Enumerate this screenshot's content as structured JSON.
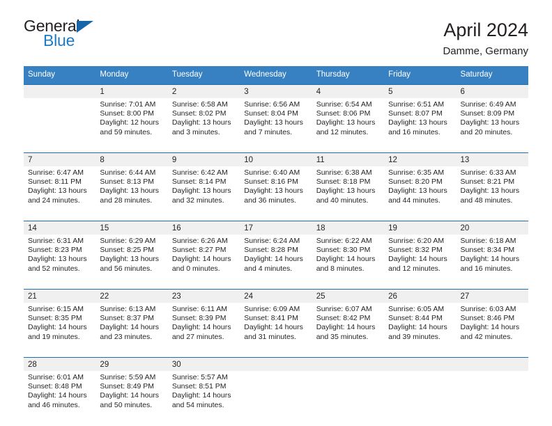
{
  "brand": {
    "name_part1": "General",
    "name_part2": "Blue",
    "accent_color": "#1f7ac4",
    "triangle_color": "#1565a8",
    "logo_icon": "triangle-icon"
  },
  "header": {
    "title": "April 2024",
    "subtitle": "Damme, Germany"
  },
  "theme": {
    "header_row_bg": "#3781c2",
    "daynum_band_bg": "#f0f0f0",
    "week_divider": "#1f6cae",
    "text_color": "#231f20"
  },
  "weekdays": [
    "Sunday",
    "Monday",
    "Tuesday",
    "Wednesday",
    "Thursday",
    "Friday",
    "Saturday"
  ],
  "weeks": [
    {
      "days": [
        {
          "num": "",
          "l1": "",
          "l2": "",
          "l3": "",
          "l4": ""
        },
        {
          "num": "1",
          "l1": "Sunrise: 7:01 AM",
          "l2": "Sunset: 8:00 PM",
          "l3": "Daylight: 12 hours",
          "l4": "and 59 minutes."
        },
        {
          "num": "2",
          "l1": "Sunrise: 6:58 AM",
          "l2": "Sunset: 8:02 PM",
          "l3": "Daylight: 13 hours",
          "l4": "and 3 minutes."
        },
        {
          "num": "3",
          "l1": "Sunrise: 6:56 AM",
          "l2": "Sunset: 8:04 PM",
          "l3": "Daylight: 13 hours",
          "l4": "and 7 minutes."
        },
        {
          "num": "4",
          "l1": "Sunrise: 6:54 AM",
          "l2": "Sunset: 8:06 PM",
          "l3": "Daylight: 13 hours",
          "l4": "and 12 minutes."
        },
        {
          "num": "5",
          "l1": "Sunrise: 6:51 AM",
          "l2": "Sunset: 8:07 PM",
          "l3": "Daylight: 13 hours",
          "l4": "and 16 minutes."
        },
        {
          "num": "6",
          "l1": "Sunrise: 6:49 AM",
          "l2": "Sunset: 8:09 PM",
          "l3": "Daylight: 13 hours",
          "l4": "and 20 minutes."
        }
      ]
    },
    {
      "days": [
        {
          "num": "7",
          "l1": "Sunrise: 6:47 AM",
          "l2": "Sunset: 8:11 PM",
          "l3": "Daylight: 13 hours",
          "l4": "and 24 minutes."
        },
        {
          "num": "8",
          "l1": "Sunrise: 6:44 AM",
          "l2": "Sunset: 8:13 PM",
          "l3": "Daylight: 13 hours",
          "l4": "and 28 minutes."
        },
        {
          "num": "9",
          "l1": "Sunrise: 6:42 AM",
          "l2": "Sunset: 8:14 PM",
          "l3": "Daylight: 13 hours",
          "l4": "and 32 minutes."
        },
        {
          "num": "10",
          "l1": "Sunrise: 6:40 AM",
          "l2": "Sunset: 8:16 PM",
          "l3": "Daylight: 13 hours",
          "l4": "and 36 minutes."
        },
        {
          "num": "11",
          "l1": "Sunrise: 6:38 AM",
          "l2": "Sunset: 8:18 PM",
          "l3": "Daylight: 13 hours",
          "l4": "and 40 minutes."
        },
        {
          "num": "12",
          "l1": "Sunrise: 6:35 AM",
          "l2": "Sunset: 8:20 PM",
          "l3": "Daylight: 13 hours",
          "l4": "and 44 minutes."
        },
        {
          "num": "13",
          "l1": "Sunrise: 6:33 AM",
          "l2": "Sunset: 8:21 PM",
          "l3": "Daylight: 13 hours",
          "l4": "and 48 minutes."
        }
      ]
    },
    {
      "days": [
        {
          "num": "14",
          "l1": "Sunrise: 6:31 AM",
          "l2": "Sunset: 8:23 PM",
          "l3": "Daylight: 13 hours",
          "l4": "and 52 minutes."
        },
        {
          "num": "15",
          "l1": "Sunrise: 6:29 AM",
          "l2": "Sunset: 8:25 PM",
          "l3": "Daylight: 13 hours",
          "l4": "and 56 minutes."
        },
        {
          "num": "16",
          "l1": "Sunrise: 6:26 AM",
          "l2": "Sunset: 8:27 PM",
          "l3": "Daylight: 14 hours",
          "l4": "and 0 minutes."
        },
        {
          "num": "17",
          "l1": "Sunrise: 6:24 AM",
          "l2": "Sunset: 8:28 PM",
          "l3": "Daylight: 14 hours",
          "l4": "and 4 minutes."
        },
        {
          "num": "18",
          "l1": "Sunrise: 6:22 AM",
          "l2": "Sunset: 8:30 PM",
          "l3": "Daylight: 14 hours",
          "l4": "and 8 minutes."
        },
        {
          "num": "19",
          "l1": "Sunrise: 6:20 AM",
          "l2": "Sunset: 8:32 PM",
          "l3": "Daylight: 14 hours",
          "l4": "and 12 minutes."
        },
        {
          "num": "20",
          "l1": "Sunrise: 6:18 AM",
          "l2": "Sunset: 8:34 PM",
          "l3": "Daylight: 14 hours",
          "l4": "and 16 minutes."
        }
      ]
    },
    {
      "days": [
        {
          "num": "21",
          "l1": "Sunrise: 6:15 AM",
          "l2": "Sunset: 8:35 PM",
          "l3": "Daylight: 14 hours",
          "l4": "and 19 minutes."
        },
        {
          "num": "22",
          "l1": "Sunrise: 6:13 AM",
          "l2": "Sunset: 8:37 PM",
          "l3": "Daylight: 14 hours",
          "l4": "and 23 minutes."
        },
        {
          "num": "23",
          "l1": "Sunrise: 6:11 AM",
          "l2": "Sunset: 8:39 PM",
          "l3": "Daylight: 14 hours",
          "l4": "and 27 minutes."
        },
        {
          "num": "24",
          "l1": "Sunrise: 6:09 AM",
          "l2": "Sunset: 8:41 PM",
          "l3": "Daylight: 14 hours",
          "l4": "and 31 minutes."
        },
        {
          "num": "25",
          "l1": "Sunrise: 6:07 AM",
          "l2": "Sunset: 8:42 PM",
          "l3": "Daylight: 14 hours",
          "l4": "and 35 minutes."
        },
        {
          "num": "26",
          "l1": "Sunrise: 6:05 AM",
          "l2": "Sunset: 8:44 PM",
          "l3": "Daylight: 14 hours",
          "l4": "and 39 minutes."
        },
        {
          "num": "27",
          "l1": "Sunrise: 6:03 AM",
          "l2": "Sunset: 8:46 PM",
          "l3": "Daylight: 14 hours",
          "l4": "and 42 minutes."
        }
      ]
    },
    {
      "days": [
        {
          "num": "28",
          "l1": "Sunrise: 6:01 AM",
          "l2": "Sunset: 8:48 PM",
          "l3": "Daylight: 14 hours",
          "l4": "and 46 minutes."
        },
        {
          "num": "29",
          "l1": "Sunrise: 5:59 AM",
          "l2": "Sunset: 8:49 PM",
          "l3": "Daylight: 14 hours",
          "l4": "and 50 minutes."
        },
        {
          "num": "30",
          "l1": "Sunrise: 5:57 AM",
          "l2": "Sunset: 8:51 PM",
          "l3": "Daylight: 14 hours",
          "l4": "and 54 minutes."
        },
        {
          "num": "",
          "l1": "",
          "l2": "",
          "l3": "",
          "l4": ""
        },
        {
          "num": "",
          "l1": "",
          "l2": "",
          "l3": "",
          "l4": ""
        },
        {
          "num": "",
          "l1": "",
          "l2": "",
          "l3": "",
          "l4": ""
        },
        {
          "num": "",
          "l1": "",
          "l2": "",
          "l3": "",
          "l4": ""
        }
      ]
    }
  ]
}
